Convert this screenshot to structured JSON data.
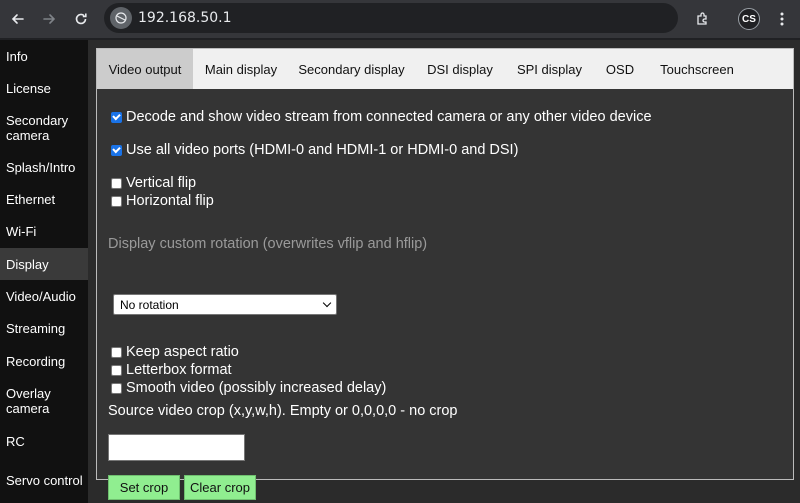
{
  "browser": {
    "url": "192.168.50.1",
    "profile_initials": "CS",
    "icons": [
      "back-icon",
      "forward-icon",
      "reload-icon",
      "site-info-icon",
      "extensions-icon",
      "menu-icon"
    ]
  },
  "sidebar": {
    "items": [
      {
        "label": "Info"
      },
      {
        "label": "License"
      },
      {
        "label": "Secondary camera"
      },
      {
        "label": "Splash/Intro"
      },
      {
        "label": "Ethernet"
      },
      {
        "label": "Wi-Fi"
      },
      {
        "label": "Display"
      },
      {
        "label": "Video/Audio"
      },
      {
        "label": "Streaming"
      },
      {
        "label": "Recording"
      },
      {
        "label": "Overlay camera"
      },
      {
        "label": "RC"
      },
      {
        "label": "Servo control"
      }
    ],
    "active": "Display"
  },
  "tabs": [
    "Video output",
    "Main display",
    "Secondary display",
    "DSI display",
    "SPI display",
    "OSD",
    "Touchscreen"
  ],
  "active_tab": "Video output",
  "form": {
    "decode_label": "Decode and show video stream from connected camera or any other video device",
    "decode_checked": true,
    "all_ports_label": "Use all video ports (HDMI-0 and HDMI-1 or HDMI-0 and DSI)",
    "all_ports_checked": true,
    "vflip_label": "Vertical flip",
    "hflip_label": "Horizontal flip",
    "rotation_heading": "Display custom rotation (overwrites vflip and hflip)",
    "rotation_value": "No rotation",
    "keep_aspect_label": "Keep aspect ratio",
    "letterbox_label": "Letterbox format",
    "smooth_label": "Smooth video (possibly increased delay)",
    "crop_label": "Source video crop (x,y,w,h). Empty or 0,0,0,0 - no crop",
    "crop_value": "",
    "set_crop_label": "Set crop",
    "clear_crop_label": "Clear crop"
  },
  "colors": {
    "button_green": "#90ee90",
    "checkbox_blue": "#1a73e8"
  }
}
